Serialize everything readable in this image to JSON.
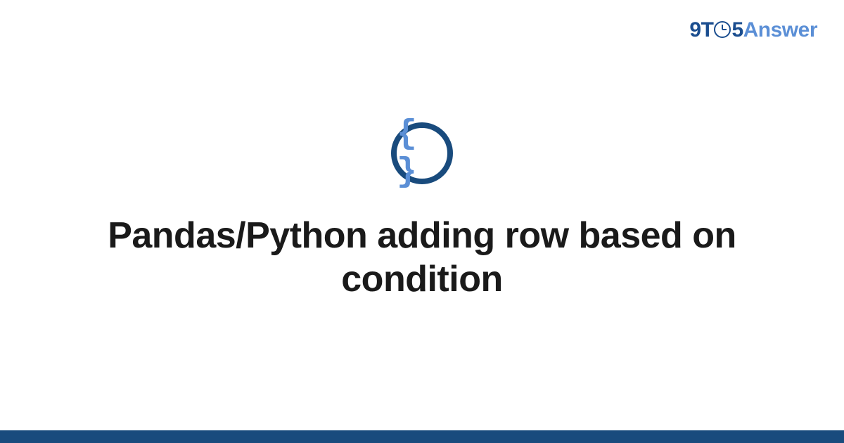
{
  "brand": {
    "part1": "9T",
    "part2": "5",
    "part3": "Answer"
  },
  "icon": {
    "name": "code-braces-icon",
    "glyph": "{ }"
  },
  "title": "Pandas/Python adding row based on condition",
  "colors": {
    "brand_dark": "#1a4d8f",
    "brand_light": "#5b8fd6",
    "icon_ring": "#194b7d",
    "footer": "#194b7d"
  }
}
